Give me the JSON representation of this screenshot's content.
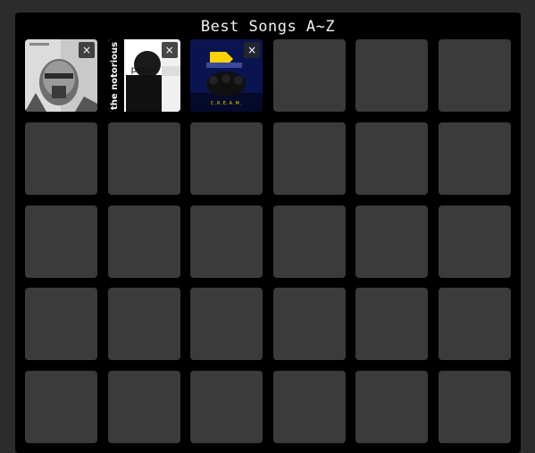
{
  "title": "Best Songs A~Z",
  "remove_glyph": "×",
  "covers": [
    {
      "name": "album-cover-1",
      "colors": [
        "#d9d9d9",
        "#8f8f8f",
        "#3a3a3a"
      ]
    },
    {
      "name": "album-cover-2",
      "side_text": "the notorious",
      "mid_text": "poppa",
      "colors": [
        "#ffffff",
        "#000000"
      ]
    },
    {
      "name": "album-cover-3",
      "caption": "C.R.E.A.M.",
      "colors": [
        "#0b1d5e",
        "#ffd200",
        "#000000"
      ]
    }
  ],
  "empty_slot_count": 27
}
